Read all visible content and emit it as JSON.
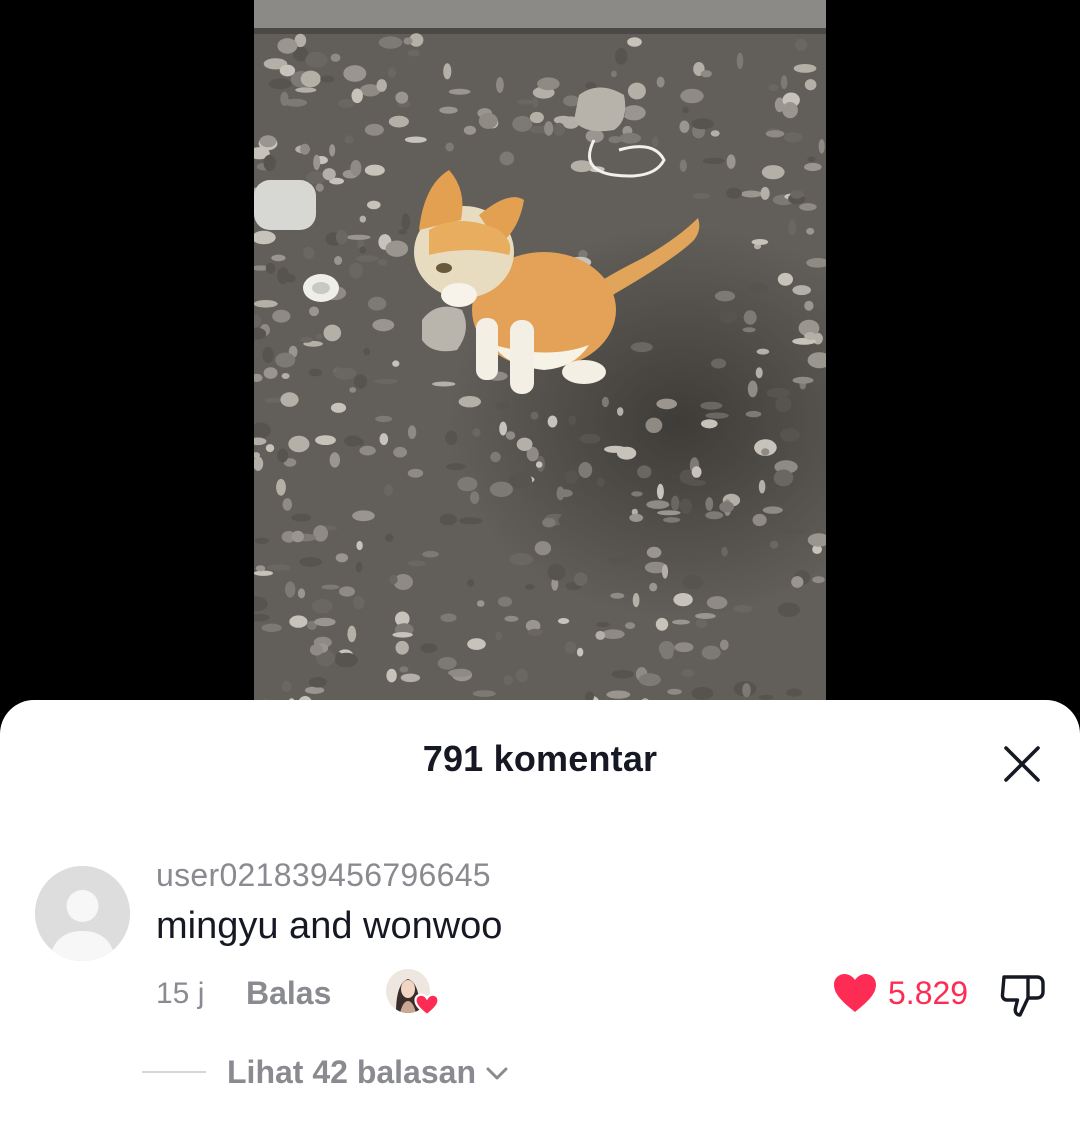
{
  "comments_sheet": {
    "title": "791 komentar",
    "close_icon": "close-icon"
  },
  "comment": {
    "username": "user021839456796645",
    "text": "mingyu and wonwoo",
    "time": "15 j",
    "reply_label": "Balas",
    "creator_liked_icon": "creator-liked-avatar-heart",
    "like_count": "5.829",
    "like_icon": "heart-icon",
    "dislike_icon": "thumbs-down-icon",
    "view_replies_label": "Lihat 42 balasan"
  },
  "colors": {
    "accent": "#fe2c55",
    "muted_text": "#8a8b91",
    "primary_text": "#161823"
  }
}
